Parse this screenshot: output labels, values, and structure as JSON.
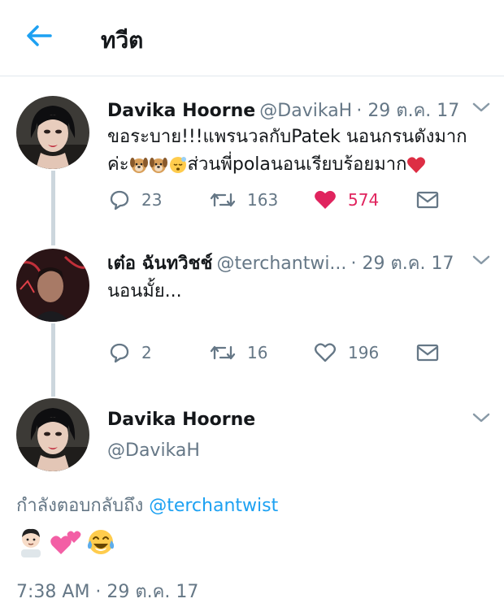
{
  "header": {
    "title": "ทวีต"
  },
  "tweets": [
    {
      "name": "Davika Hoorne",
      "handle": "@DavikaH",
      "date": "· 29 ต.ค. 17",
      "line1": "ขอระบาย!!!แพรนวลกับPatek นอนกรนดังมาก",
      "line2_a": "ค่ะ",
      "line2_b": "ส่วนพี่polaนอนเรียบร้อยมาก",
      "replies": "23",
      "retweets": "163",
      "likes": "574"
    },
    {
      "name": "เต๋อ ฉันทวิชช์",
      "handle": "@terchantwi...",
      "date": "· 29 ต.ค. 17",
      "line1": "นอนมั้ย...",
      "replies": "2",
      "retweets": "16",
      "likes": "196"
    }
  ],
  "main_tweet": {
    "name": "Davika Hoorne",
    "handle": "@DavikaH",
    "reply_prefix": "กำลังตอบกลับถึง",
    "reply_to": "@terchantwist",
    "timestamp": "7:38 AM · 29 ต.ค. 17"
  },
  "colors": {
    "accent": "#1da1f2",
    "like": "#e0245e",
    "muted": "#657786",
    "thread_line": "#ccd6dd"
  },
  "icons": [
    "back-arrow-icon",
    "chevron-down-icon",
    "reply-icon",
    "retweet-icon",
    "heart-icon",
    "message-icon",
    "dog-emoji",
    "sleeping-emoji",
    "heart-emoji",
    "boy-emoji",
    "two-hearts-emoji",
    "tears-of-joy-emoji"
  ]
}
